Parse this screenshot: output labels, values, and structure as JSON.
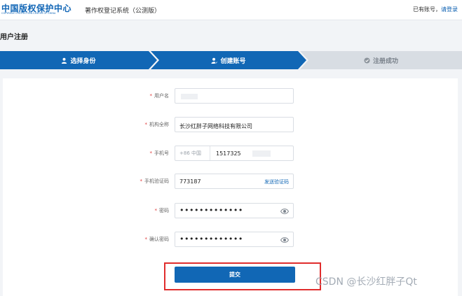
{
  "header": {
    "logo_cn": "中国版权保护中心",
    "logo_en": "COPYRIGHT PROTECTION CENTER OF CHINA",
    "system_title": "著作权登记系统（公测版）",
    "has_account_text": "已有账号，",
    "login_link": "请登录"
  },
  "page_title": "用户注册",
  "steps": [
    {
      "label": "选择身份",
      "icon": "user-icon",
      "state": "done"
    },
    {
      "label": "创建账号",
      "icon": "user-edit-icon",
      "state": "active"
    },
    {
      "label": "注册成功",
      "icon": "check-circle-icon",
      "state": "pending"
    }
  ],
  "form": {
    "username": {
      "label": "用户名",
      "value": ""
    },
    "org_name": {
      "label": "机构全称",
      "value": "长沙红胖子网络科技有限公司"
    },
    "phone": {
      "label": "手机号",
      "prefix": "+86 中国",
      "value": "1517325"
    },
    "sms_code": {
      "label": "手机验证码",
      "value": "773187",
      "send_label": "发送验证码"
    },
    "password": {
      "label": "密码",
      "value": "•••••••••••••"
    },
    "confirm_password": {
      "label": "确认密码",
      "value": "•••••••••••••"
    },
    "required_mark": "*",
    "submit_label": "提交"
  },
  "watermark": "CSDN @长沙红胖子Qt",
  "colors": {
    "primary": "#1167b5",
    "highlight": "#e02d2d",
    "pending_step": "#d8dde3"
  }
}
